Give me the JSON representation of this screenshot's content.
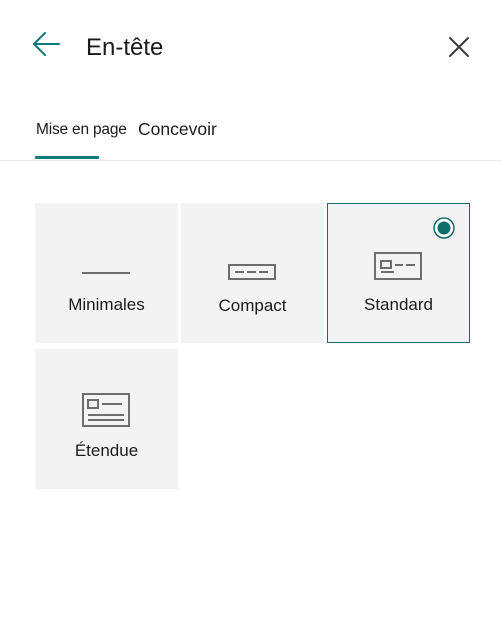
{
  "header": {
    "title": "En-tête",
    "back_icon": "arrow-left-icon",
    "close_icon": "close-icon"
  },
  "tabs": [
    {
      "label": "Mise en page",
      "active": true
    },
    {
      "label": "Concevoir",
      "active": false
    }
  ],
  "options": [
    {
      "label": "Minimales",
      "icon": "minimal-header-icon",
      "selected": false
    },
    {
      "label": "Compact",
      "icon": "compact-header-icon",
      "selected": false
    },
    {
      "label": "Standard",
      "icon": "standard-header-icon",
      "selected": true
    },
    {
      "label": "Étendue",
      "icon": "extended-header-icon",
      "selected": false
    }
  ],
  "colors": {
    "accent": "#0f7a7a",
    "card_background": "#f3f3f3",
    "icon_gray": "#6e6e6e",
    "text": "#1b1b1b"
  }
}
